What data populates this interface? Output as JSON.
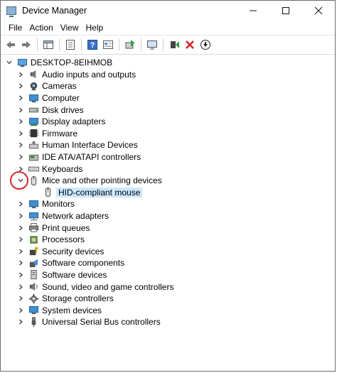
{
  "window": {
    "title": "Device Manager"
  },
  "menu": [
    "File",
    "Action",
    "View",
    "Help"
  ],
  "toolbar": [
    "back-icon",
    "forward-icon",
    "properties-pane-icon",
    "properties-icon",
    "help-icon",
    "details-icon",
    "update-driver-icon",
    "scan-hardware-icon",
    "enable-device-icon",
    "uninstall-icon",
    "download-icon"
  ],
  "tree": {
    "root": "DESKTOP-8EIHMOB",
    "categories": [
      "Audio inputs and outputs",
      "Cameras",
      "Computer",
      "Disk drives",
      "Display adapters",
      "Firmware",
      "Human Interface Devices",
      "IDE ATA/ATAPI controllers",
      "Keyboards",
      "Mice and other pointing devices",
      "Monitors",
      "Network adapters",
      "Print queues",
      "Processors",
      "Security devices",
      "Software components",
      "Software devices",
      "Sound, video and game controllers",
      "Storage controllers",
      "System devices",
      "Universal Serial Bus controllers"
    ],
    "expanded_child": "HID-compliant mouse"
  },
  "colors": {
    "selection": "#cce8ff",
    "highlight_circle": "#d42a2a"
  }
}
